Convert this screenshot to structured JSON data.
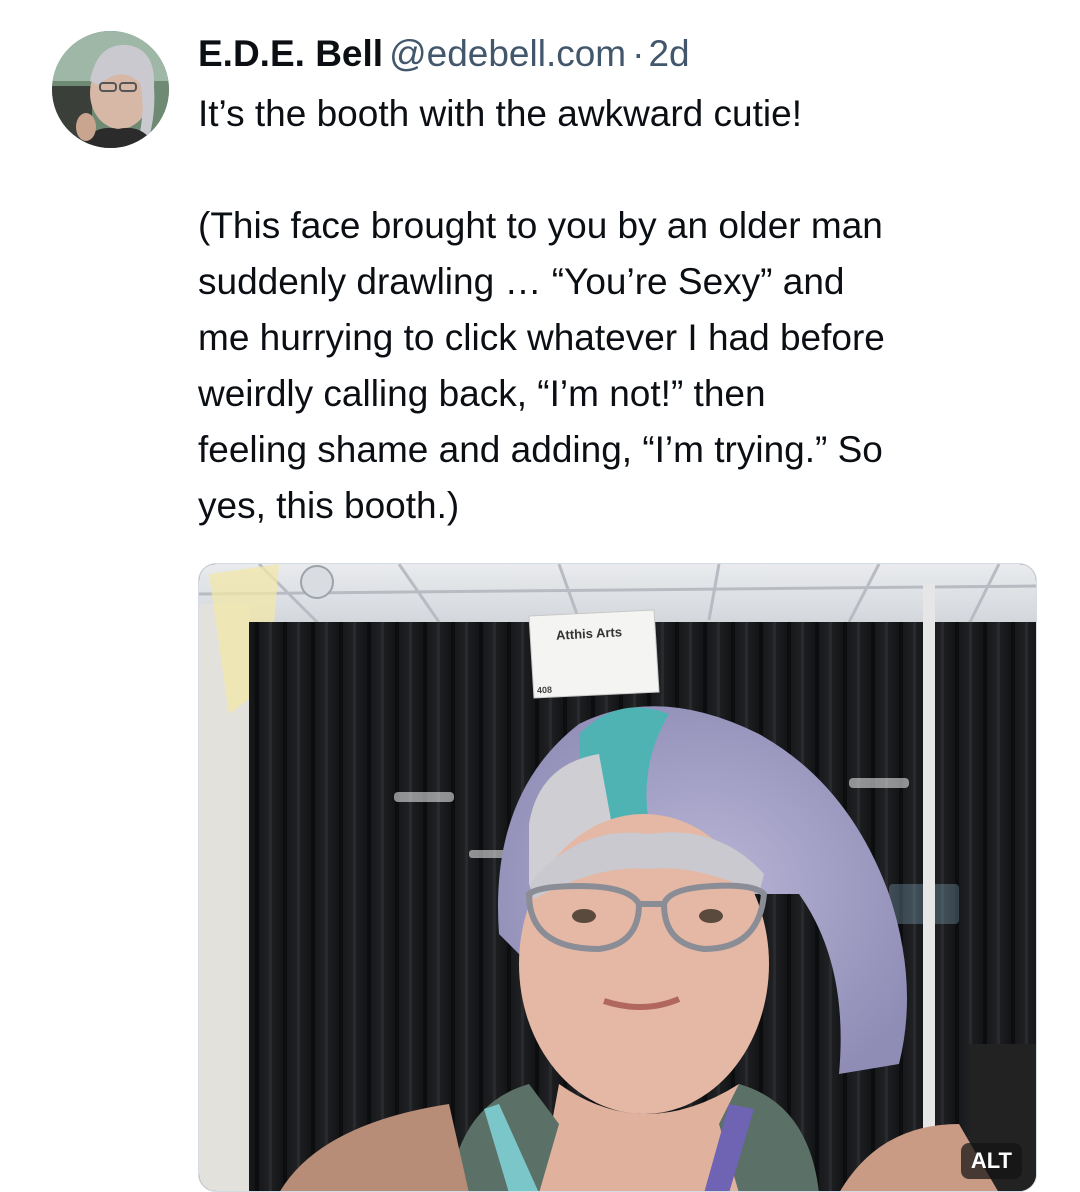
{
  "post": {
    "author": {
      "display_name": "E.D.E. Bell",
      "handle": "@edebell.com",
      "separator": "·",
      "timestamp": "2d"
    },
    "text_lines": {
      "line1": "It’s the booth with the awkward cutie!",
      "line2": "(This face brought to you by an older man",
      "line3": "suddenly drawling … “You’re Sexy” and",
      "line4": "me hurrying to click whatever I had before",
      "line5": "weirdly calling back, “I’m not!” then",
      "line6": "feeling shame and adding, “I’m trying.” So",
      "line7": "yes, this booth.)"
    },
    "image": {
      "sign_text": "Atthis Arts",
      "sign_number": "408",
      "alt_badge": "ALT"
    }
  },
  "colors": {
    "text": "#0b0f14",
    "muted": "#42576c",
    "border": "#d4dbe2"
  }
}
